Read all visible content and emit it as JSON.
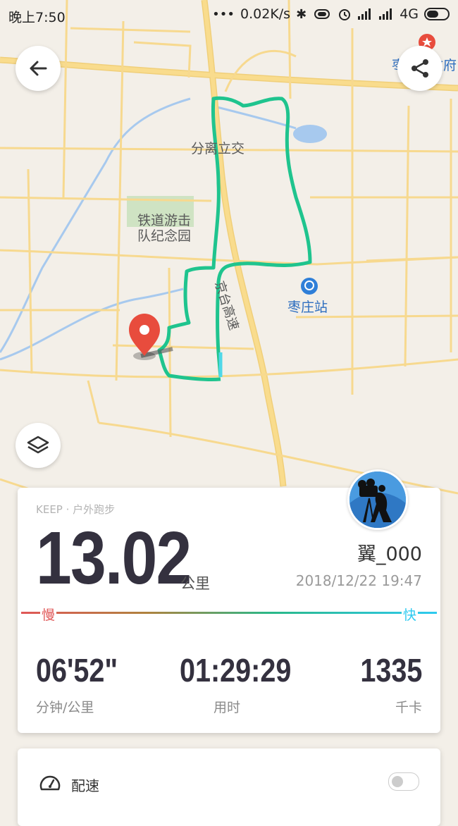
{
  "status_bar": {
    "time": "晚上7:50",
    "net_speed": "0.02K/s",
    "network": "4G"
  },
  "map": {
    "labels": {
      "interchange": "分离立交",
      "memorial": "铁道游击",
      "memorial_2": "队纪念园",
      "station": "枣庄站",
      "expressway": "京台高速",
      "gov_top": "枣",
      "gov_top_2": "政府"
    },
    "colors": {
      "route": "#1fc48e",
      "pin": "#e84c3d",
      "road": "#f9dc8d",
      "water": "#a7c9ee"
    }
  },
  "toolbar": {
    "back_icon": "arrow-left-icon",
    "share_icon": "share-icon",
    "layers_icon": "layers-icon"
  },
  "summary": {
    "source": "KEEP · 户外跑步",
    "distance": "13.02",
    "distance_unit": "公里",
    "username": "翼_000",
    "datetime": "2018/12/22 19:47",
    "slow_label": "慢",
    "fast_label": "快",
    "pace": "06'52\"",
    "pace_label": "分钟/公里",
    "duration": "01:29:29",
    "duration_label": "用时",
    "calories": "1335",
    "calories_label": "千卡"
  },
  "pace_panel": {
    "label": "配速",
    "toggle_on": false
  }
}
